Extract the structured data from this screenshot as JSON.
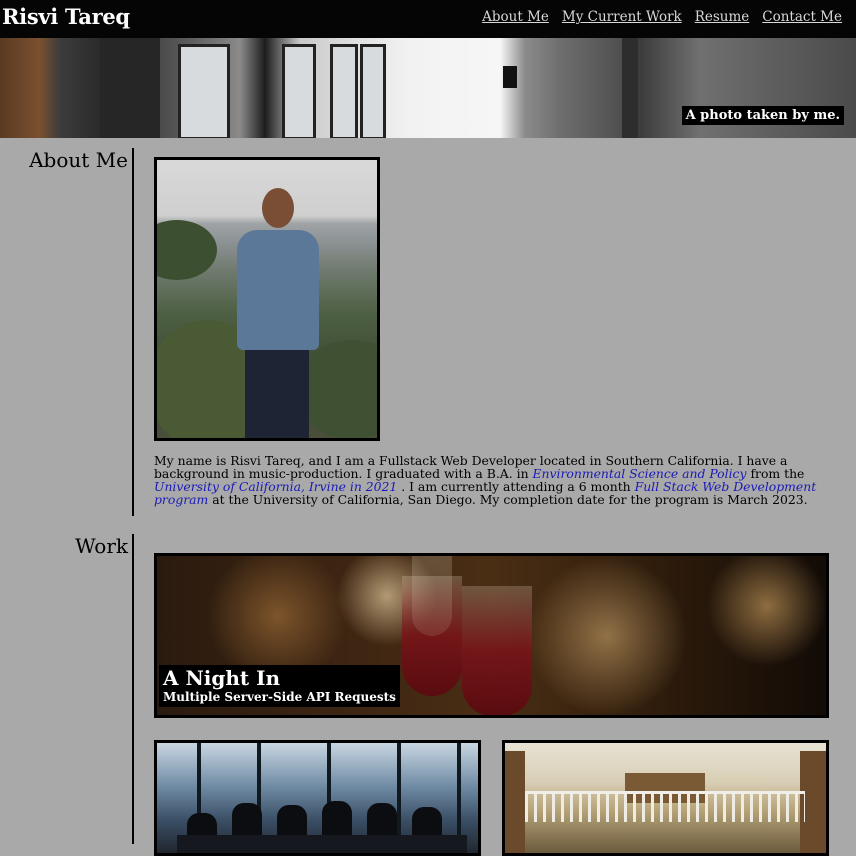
{
  "header": {
    "brand": "Risvi Tareq",
    "nav": [
      {
        "label": "About Me"
      },
      {
        "label": "My Current Work"
      },
      {
        "label": "Resume"
      },
      {
        "label": "Contact Me"
      }
    ]
  },
  "hero": {
    "caption": "A photo taken by me."
  },
  "about": {
    "title": "About Me",
    "bio_part1": "My name is Risvi Tareq, and I am a Fullstack Web Developer located in Southern California. I have a background in music-production. I graduated with a B.A. in ",
    "link_degree": "Environmental Science and Policy",
    "bio_part2": " from the ",
    "link_university": "University of California, Irvine in 2021",
    "bio_part3": " . I am currently attending a 6 month ",
    "link_program": "Full Stack Web Development program",
    "bio_part4": " at the University of California, San Diego. My completion date for the program is March 2023."
  },
  "work": {
    "title": "Work",
    "featured": {
      "title": "A Night In",
      "subtitle": "Multiple Server-Side API Requests"
    }
  }
}
